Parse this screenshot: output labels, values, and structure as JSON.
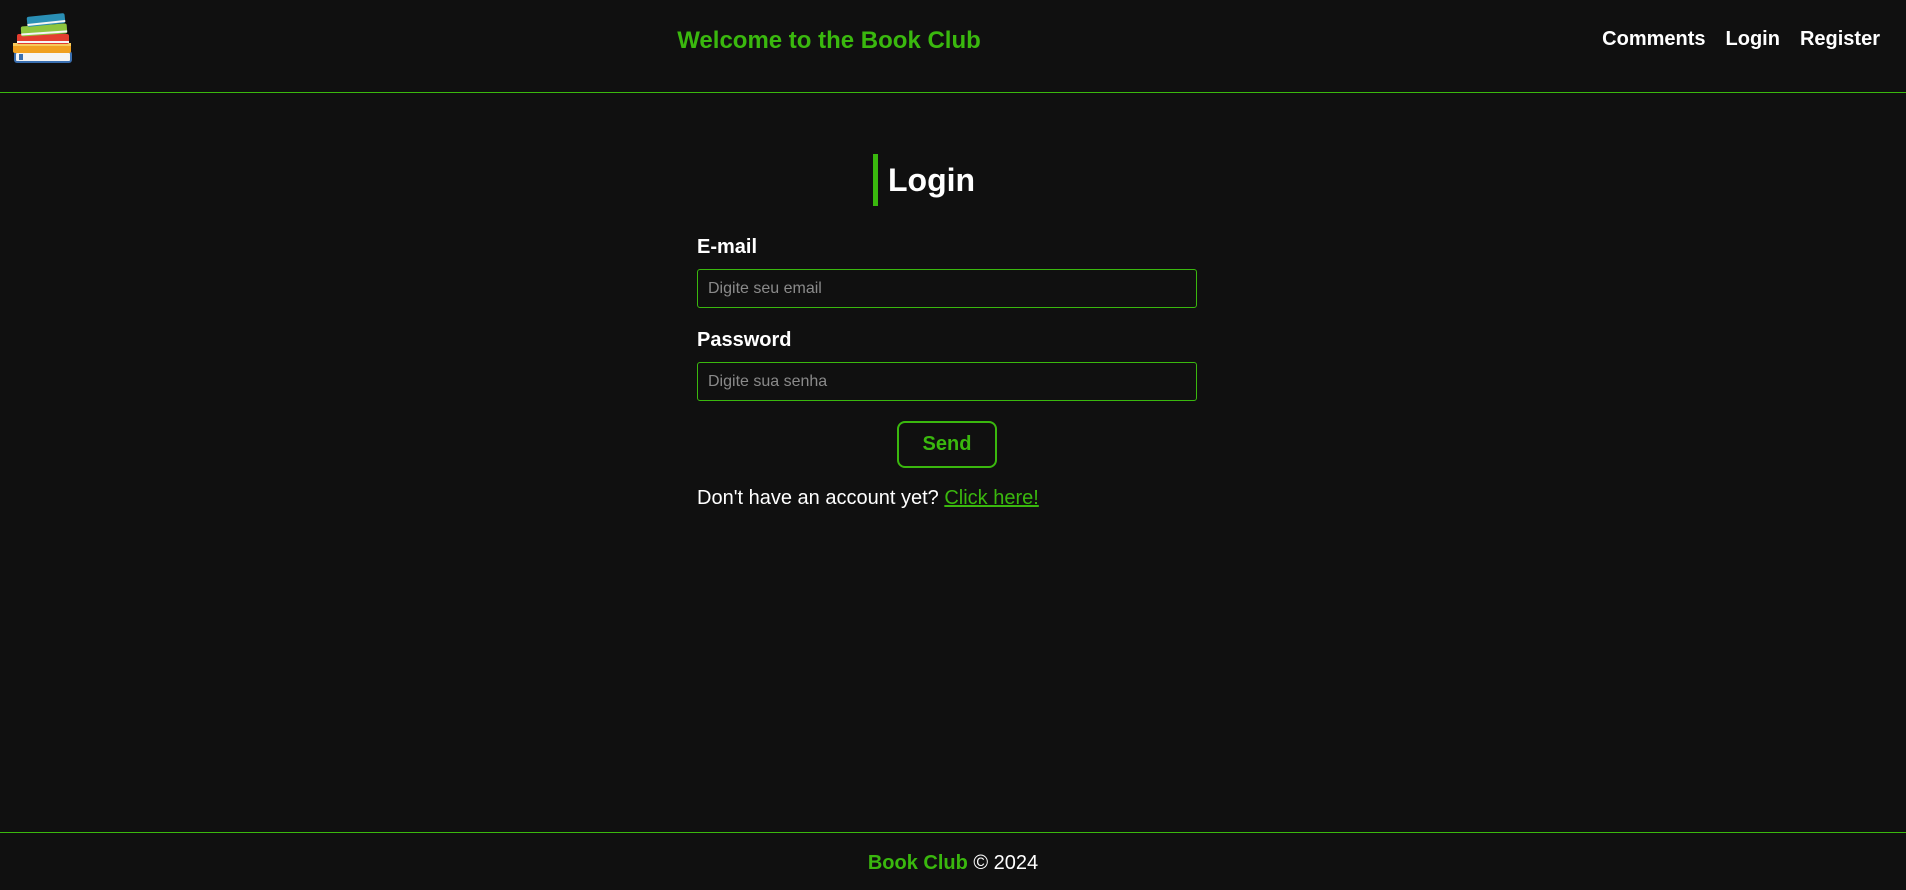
{
  "header": {
    "title": "Welcome to the Book Club",
    "logo_icon": "books-stack-icon",
    "nav": {
      "comments": "Comments",
      "login": "Login",
      "register": "Register"
    }
  },
  "login_form": {
    "heading": "Login",
    "email_label": "E-mail",
    "email_placeholder": "Digite seu email",
    "email_value": "",
    "password_label": "Password",
    "password_placeholder": "Digite sua senha",
    "password_value": "",
    "send_label": "Send",
    "register_prompt": "Don't have an account yet?",
    "register_link": "Click here!"
  },
  "footer": {
    "brand": "Book Club",
    "copyright": "© 2024"
  },
  "colors": {
    "accent": "#3ab80e",
    "background": "#101010",
    "text": "#ffffff",
    "placeholder": "#8a8a8a"
  }
}
